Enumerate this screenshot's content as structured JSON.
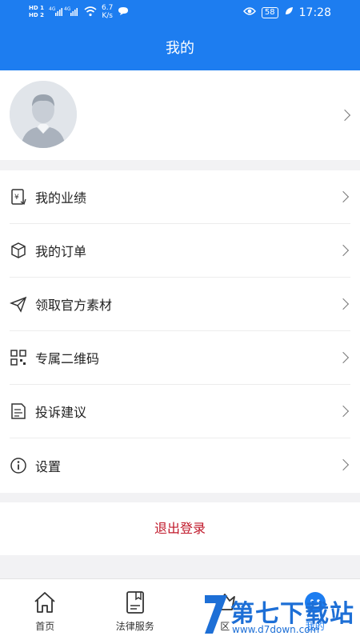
{
  "status_bar": {
    "sim1": "HD 1",
    "sim2": "HD 2",
    "net1": "4G",
    "net2": "4G",
    "speed_value": "6.7",
    "speed_unit": "K/s",
    "battery": "58",
    "time": "17:28"
  },
  "header": {
    "title": "我的"
  },
  "menu": {
    "items": [
      {
        "label": "我的业绩",
        "icon": "receipt-yen-icon"
      },
      {
        "label": "我的订单",
        "icon": "box-icon"
      },
      {
        "label": "领取官方素材",
        "icon": "paper-plane-icon"
      },
      {
        "label": "专属二维码",
        "icon": "qr-code-icon"
      },
      {
        "label": "投诉建议",
        "icon": "document-icon"
      },
      {
        "label": "设置",
        "icon": "info-icon"
      }
    ]
  },
  "logout": {
    "label": "退出登录"
  },
  "tabbar": {
    "tabs": [
      {
        "label": "首页",
        "icon": "home-icon"
      },
      {
        "label": "法律服务",
        "icon": "book-icon"
      },
      {
        "label": "区",
        "icon": "crown-icon"
      },
      {
        "label": "我的",
        "icon": "profile-icon"
      }
    ]
  },
  "watermark": {
    "text": "第七下载站",
    "url": "www.d7down.com"
  },
  "colors": {
    "brand": "#1d7df0",
    "logout": "#c0182a",
    "background": "#f2f2f4"
  }
}
